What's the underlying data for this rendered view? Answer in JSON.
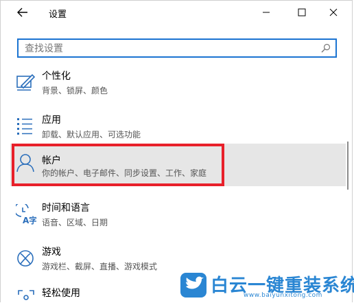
{
  "window": {
    "title": "设置",
    "search_placeholder": "查找设置"
  },
  "icons": {
    "back": "back-arrow-icon",
    "minimize": "minimize-icon",
    "maximize": "maximize-icon",
    "close": "close-icon",
    "search": "search-icon"
  },
  "colors": {
    "accent": "#1a73d1",
    "highlight": "#e8202a",
    "selected_bg": "#e6e6e6",
    "icon": "#2a6ebb",
    "watermark": "#2a86d3"
  },
  "categories": [
    {
      "name": "个性化",
      "desc": "背景、锁屏、颜色",
      "icon": "personalization-icon"
    },
    {
      "name": "应用",
      "desc": "卸载、默认应用、可选功能",
      "icon": "apps-icon"
    },
    {
      "name": "帐户",
      "desc": "你的帐户、电子邮件、同步设置、工作、家庭",
      "icon": "account-icon",
      "selected": true
    },
    {
      "name": "时间和语言",
      "desc": "语音、区域、日期",
      "icon": "time-language-icon"
    },
    {
      "name": "游戏",
      "desc": "游戏栏、截屏、直播、游戏模式",
      "icon": "gaming-icon"
    },
    {
      "name": "轻松使用",
      "desc": "",
      "icon": "ease-of-access-icon"
    }
  ],
  "watermark": {
    "text": "白云一键重装系统",
    "url": "www.baiyunxitong.com"
  }
}
